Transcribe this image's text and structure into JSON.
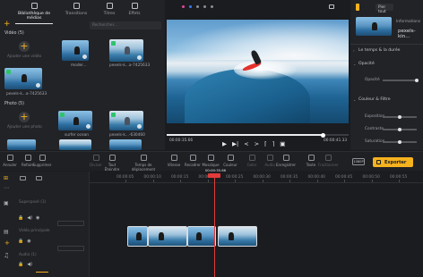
{
  "media_tabs": [
    {
      "label": "Bibliothèque de médias",
      "icon": "media-library-icon",
      "active": true
    },
    {
      "label": "Transitions",
      "icon": "transitions-icon",
      "active": false
    },
    {
      "label": "Titres",
      "icon": "titles-icon",
      "active": false
    },
    {
      "label": "Effets",
      "icon": "effects-icon",
      "active": false
    }
  ],
  "search": {
    "placeholder": "Rechercher..."
  },
  "video_section": {
    "title": "Vidéo (5)",
    "add_label": "Ajouter une vidéo",
    "items": [
      {
        "label": "moder..."
      },
      {
        "label": "pexels-k...a-7425633"
      },
      {
        "label": "pexels-k...a-7425633"
      }
    ]
  },
  "photo_section": {
    "title": "Photo (5)",
    "add_label": "Ajouter une photo",
    "items": [
      {
        "label": "surfer ocean"
      },
      {
        "label": "pexels-k...-630460"
      }
    ]
  },
  "player": {
    "time_current": "00:00:35.66",
    "time_total": "00:00:41.33",
    "progress": 0.86
  },
  "right_panel": {
    "replace_label": "Pier tout",
    "info_label": "Informations",
    "clip_name": "pexels-kin...",
    "sections": [
      {
        "title": "Le temps & la durée"
      },
      {
        "title": "Opacité"
      },
      {
        "title": "Couleur & Filtre"
      }
    ],
    "opacity_label": "Opacité",
    "color_params": [
      "Exposition",
      "Contraste",
      "Saturation"
    ]
  },
  "toolbar": [
    {
      "label": "Annuler",
      "icon": "undo-icon"
    },
    {
      "label": "Refaire",
      "icon": "redo-icon"
    },
    {
      "label": "Supprimer",
      "icon": "delete-icon"
    },
    {
      "label": "Diviser",
      "icon": "split-icon",
      "dim": true
    },
    {
      "label": "Tout Éteindre",
      "icon": "power-icon"
    },
    {
      "label": "Temps de déplacement",
      "icon": "move-time-icon"
    },
    {
      "label": "Vitesse",
      "icon": "speed-icon"
    },
    {
      "label": "Recadrer",
      "icon": "crop-icon"
    },
    {
      "label": "Mosaïque",
      "icon": "mosaic-icon"
    },
    {
      "label": "Couleur",
      "icon": "color-icon"
    },
    {
      "label": "Geler",
      "icon": "freeze-icon",
      "dim": true
    },
    {
      "label": "Audio",
      "icon": "audio-icon",
      "dim": true
    },
    {
      "label": "Enregistrer",
      "icon": "record-icon"
    },
    {
      "label": "Texte",
      "icon": "text-icon"
    },
    {
      "label": "Fractionner",
      "icon": "fraction-icon",
      "dim": true
    }
  ],
  "hd_badge": "1080P",
  "export_label": "Exporter",
  "playhead_time": "00:00:35.66",
  "timeline_ticks": [
    "00:00:05",
    "00:00:10",
    "00:00:15",
    "00:00:20",
    "00:00:25",
    "00:00:30",
    "00:00:35",
    "00:00:40",
    "00:00:45",
    "00:00:50",
    "00:00:55",
    "00:01:00"
  ],
  "tracks": [
    {
      "name": "Superposé (1) ",
      "type": "overlay"
    },
    {
      "name": "Vidéo principale",
      "type": "main"
    },
    {
      "name": "Audio (1)",
      "type": "audio"
    }
  ],
  "brand": {
    "accent": "#f5b21f",
    "playhead": "#e23b3b",
    "export_bg": "#f5b21f"
  }
}
